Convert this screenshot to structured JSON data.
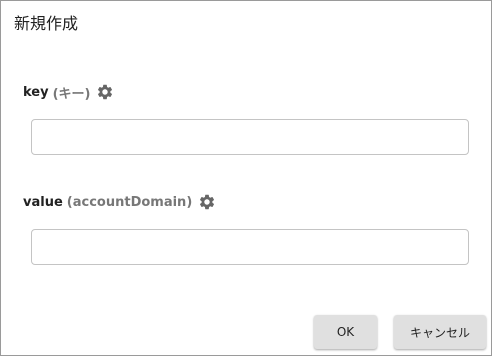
{
  "dialog": {
    "title": "新規作成"
  },
  "fields": {
    "key": {
      "label": "key",
      "hint": "(キー)",
      "value": "",
      "icon": "gear-icon"
    },
    "value": {
      "label": "value",
      "hint": "(accountDomain)",
      "value": "",
      "icon": "gear-icon"
    }
  },
  "buttons": {
    "ok_label": "OK",
    "cancel_label": "キャンセル"
  },
  "colors": {
    "icon": "#666666",
    "button_bg": "#e0e0e0",
    "input_border": "#c4c4c4"
  }
}
